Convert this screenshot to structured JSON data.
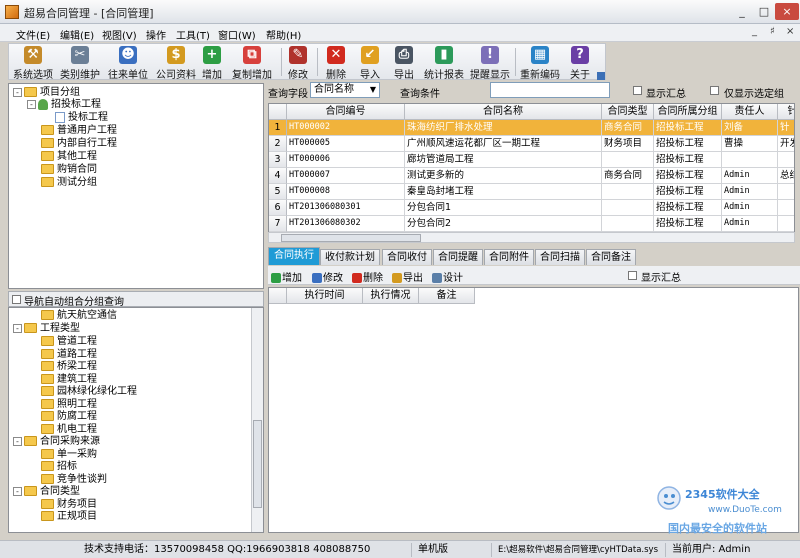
{
  "window": {
    "title": "超易合同管理 - [合同管理]",
    "controls": [
      "_",
      "□",
      "×"
    ],
    "mdi_controls": [
      "_",
      "♯",
      "×"
    ]
  },
  "menu": [
    "文件(E)",
    "编辑(E)",
    "视图(V)",
    "操作",
    "工具(T)",
    "窗口(W)",
    "帮助(H)"
  ],
  "toolbar": {
    "buttons": [
      {
        "label": "系统选项",
        "icon": "hammer-icon",
        "color": "#c48a2a"
      },
      {
        "label": "类别维护",
        "icon": "tools-icon",
        "color": "#6b7f96"
      },
      {
        "label": "往来单位",
        "icon": "person-icon",
        "color": "#3a6fc0"
      },
      {
        "label": "公司资料",
        "icon": "coins-icon",
        "color": "#d39a20"
      },
      {
        "label": "增加",
        "icon": "add-user-icon",
        "color": "#2d9e44"
      },
      {
        "label": "复制增加",
        "icon": "copy-add-icon",
        "color": "#d7403c"
      },
      {
        "label": "修改",
        "icon": "pencil-icon",
        "color": "#b0322c"
      },
      {
        "label": "删除",
        "icon": "delete-icon",
        "color": "#d12a1e"
      },
      {
        "label": "导入",
        "icon": "import-icon",
        "color": "#e0a021"
      },
      {
        "label": "导出",
        "icon": "printer-icon",
        "color": "#4a5563"
      },
      {
        "label": "统计报表",
        "icon": "bar-chart-icon",
        "color": "#2c9a5a"
      },
      {
        "label": "提醒显示",
        "icon": "reminder-icon",
        "color": "#7c6fb8"
      },
      {
        "label": "重新编码",
        "icon": "barcode-icon",
        "color": "#2a83c7"
      },
      {
        "label": "关于",
        "icon": "help-icon",
        "color": "#6a3ea5"
      }
    ]
  },
  "tree_top": {
    "items": [
      {
        "label": "项目分组",
        "level": 0,
        "expander": "-",
        "icon": "folder"
      },
      {
        "label": "招投标工程",
        "level": 1,
        "expander": "-",
        "icon": "person"
      },
      {
        "label": "投标工程",
        "level": 2,
        "expander": "",
        "icon": "doc"
      },
      {
        "label": "普通用户工程",
        "level": 1,
        "expander": "",
        "icon": "folder"
      },
      {
        "label": "内部自行工程",
        "level": 1,
        "expander": "",
        "icon": "folder"
      },
      {
        "label": "其他工程",
        "level": 1,
        "expander": "",
        "icon": "folder"
      },
      {
        "label": "购销合同",
        "level": 1,
        "expander": "",
        "icon": "folder"
      },
      {
        "label": "测试分组",
        "level": 1,
        "expander": "",
        "icon": "folder"
      }
    ]
  },
  "nav": {
    "label": "导航自动组合分组查询"
  },
  "tree_bottom": {
    "items": [
      {
        "label": "航天航空通信",
        "level": 2,
        "expander": "",
        "icon": "folder"
      },
      {
        "label": "工程类型",
        "level": 1,
        "expander": "-",
        "icon": "folder"
      },
      {
        "label": "管道工程",
        "level": 2,
        "expander": "",
        "icon": "folder"
      },
      {
        "label": "道路工程",
        "level": 2,
        "expander": "",
        "icon": "folder"
      },
      {
        "label": "桥梁工程",
        "level": 2,
        "expander": "",
        "icon": "folder"
      },
      {
        "label": "建筑工程",
        "level": 2,
        "expander": "",
        "icon": "folder"
      },
      {
        "label": "园林绿化绿化工程",
        "level": 2,
        "expander": "",
        "icon": "folder"
      },
      {
        "label": "照明工程",
        "level": 2,
        "expander": "",
        "icon": "folder"
      },
      {
        "label": "防腐工程",
        "level": 2,
        "expander": "",
        "icon": "folder"
      },
      {
        "label": "机电工程",
        "level": 2,
        "expander": "",
        "icon": "folder"
      },
      {
        "label": "合同采购来源",
        "level": 1,
        "expander": "-",
        "icon": "folder"
      },
      {
        "label": "单一采购",
        "level": 2,
        "expander": "",
        "icon": "folder"
      },
      {
        "label": "招标",
        "level": 2,
        "expander": "",
        "icon": "folder"
      },
      {
        "label": "竞争性谈判",
        "level": 2,
        "expander": "",
        "icon": "folder"
      },
      {
        "label": "合同类型",
        "level": 1,
        "expander": "-",
        "icon": "folder"
      },
      {
        "label": "财务项目",
        "level": 2,
        "expander": "",
        "icon": "folder"
      },
      {
        "label": "正规项目",
        "level": 2,
        "expander": "",
        "icon": "folder"
      }
    ]
  },
  "query": {
    "field_label": "查询字段",
    "field_value": "合同名称",
    "condition_label": "查询条件",
    "condition_value": "",
    "show_summary": "显示汇总",
    "only_selected": "仅显示选定组"
  },
  "grid": {
    "columns": [
      "合同编号",
      "合同名称",
      "合同类型",
      "合同所属分组",
      "责任人",
      "针"
    ],
    "rows": [
      {
        "num": "1",
        "code": "HT000002",
        "name": "珠海纺织厂排水处理",
        "type": "商务合同",
        "group": "招投标工程",
        "owner": "刘备",
        "extra": "针"
      },
      {
        "num": "2",
        "code": "HT000005",
        "name": "广州顺风速运花都厂区一期工程",
        "type": "财务项目",
        "group": "招投标工程",
        "owner": "曹操",
        "extra": "开发"
      },
      {
        "num": "3",
        "code": "HT000006",
        "name": "廊坊管道局工程",
        "type": "",
        "group": "招投标工程",
        "owner": "",
        "extra": ""
      },
      {
        "num": "4",
        "code": "HT000007",
        "name": "测试更多新的",
        "type": "商务合同",
        "group": "招投标工程",
        "owner": "Admin",
        "extra": "总结"
      },
      {
        "num": "5",
        "code": "HT000008",
        "name": "秦皇岛封堵工程",
        "type": "",
        "group": "招投标工程",
        "owner": "Admin",
        "extra": ""
      },
      {
        "num": "6",
        "code": "HT201306080301",
        "name": "分包合同1",
        "type": "",
        "group": "招投标工程",
        "owner": "Admin",
        "extra": ""
      },
      {
        "num": "7",
        "code": "HT201306080302",
        "name": "分包合同2",
        "type": "",
        "group": "招投标工程",
        "owner": "Admin",
        "extra": ""
      }
    ],
    "selected_row": 0
  },
  "tabs": [
    "合同执行",
    "收付款计划",
    "合同收付",
    "合同提醒",
    "合同附件",
    "合同扫描",
    "合同备注"
  ],
  "active_tab": 0,
  "subtoolbar": {
    "buttons": [
      {
        "label": "增加",
        "icon": "add-icon",
        "color": "#2d9e44"
      },
      {
        "label": "修改",
        "icon": "edit-icon",
        "color": "#3a6fc0"
      },
      {
        "label": "删除",
        "icon": "delete-icon",
        "color": "#d12a1e"
      },
      {
        "label": "导出",
        "icon": "export-icon",
        "color": "#d39a20"
      },
      {
        "label": "设计",
        "icon": "design-icon",
        "color": "#5a7fa8"
      }
    ],
    "show_summary": "显示汇总"
  },
  "subgrid": {
    "columns": [
      "执行时间",
      "执行情况",
      "备注"
    ]
  },
  "status": {
    "support": "技术支持电话：13570098458 QQ:1966903818 408088750",
    "edition": "单机版",
    "path": "E:\\超易软件\\超易合同管理\\cyHTData.sys",
    "user": "当前用户: Admin"
  },
  "watermark": {
    "brand": "2345软件大全",
    "site": "www.DuoTe.com",
    "slogan": "国内最安全的软件站"
  },
  "colors": {
    "selection": "#f1b33b",
    "active_tab": "#1f9bd6",
    "folder": "#f5c84c"
  }
}
